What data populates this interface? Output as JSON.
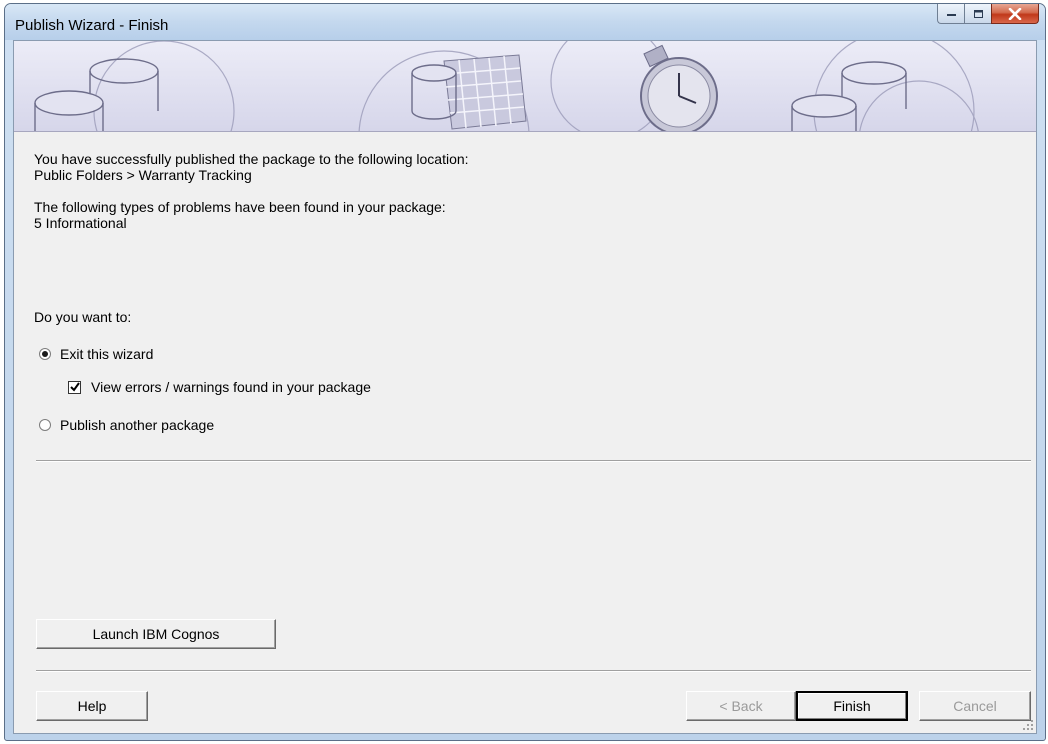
{
  "window": {
    "title": "Publish Wizard - Finish",
    "controls": {
      "minimize": "minimize",
      "maximize": "maximize",
      "close": "close"
    }
  },
  "message": {
    "published_intro": "You have successfully published the package to the following location:",
    "location": "Public Folders > Warranty Tracking",
    "problems_intro": "The following types of problems have been found in your package:",
    "problems": "5  Informational"
  },
  "options": {
    "prompt": "Do you want to:",
    "exit_label": "Exit this wizard",
    "exit_selected": true,
    "view_errors_label": "View errors / warnings found in your package",
    "view_errors_checked": true,
    "publish_another_label": "Publish another package",
    "publish_another_selected": false
  },
  "buttons": {
    "launch": "Launch IBM Cognos",
    "help": "Help",
    "back": "< Back",
    "finish": "Finish",
    "cancel": "Cancel"
  },
  "colors": {
    "title_bar": "#c4d8ee",
    "banner": "#e1e1f1",
    "dialog_bg": "#f0f0f0",
    "close_button": "#c0381a",
    "disabled_text": "#9a9a9a"
  },
  "icons": [
    "minimize-icon",
    "maximize-icon",
    "close-icon",
    "database-icon",
    "spreadsheet-icon",
    "stopwatch-icon",
    "resize-grip-icon"
  ]
}
